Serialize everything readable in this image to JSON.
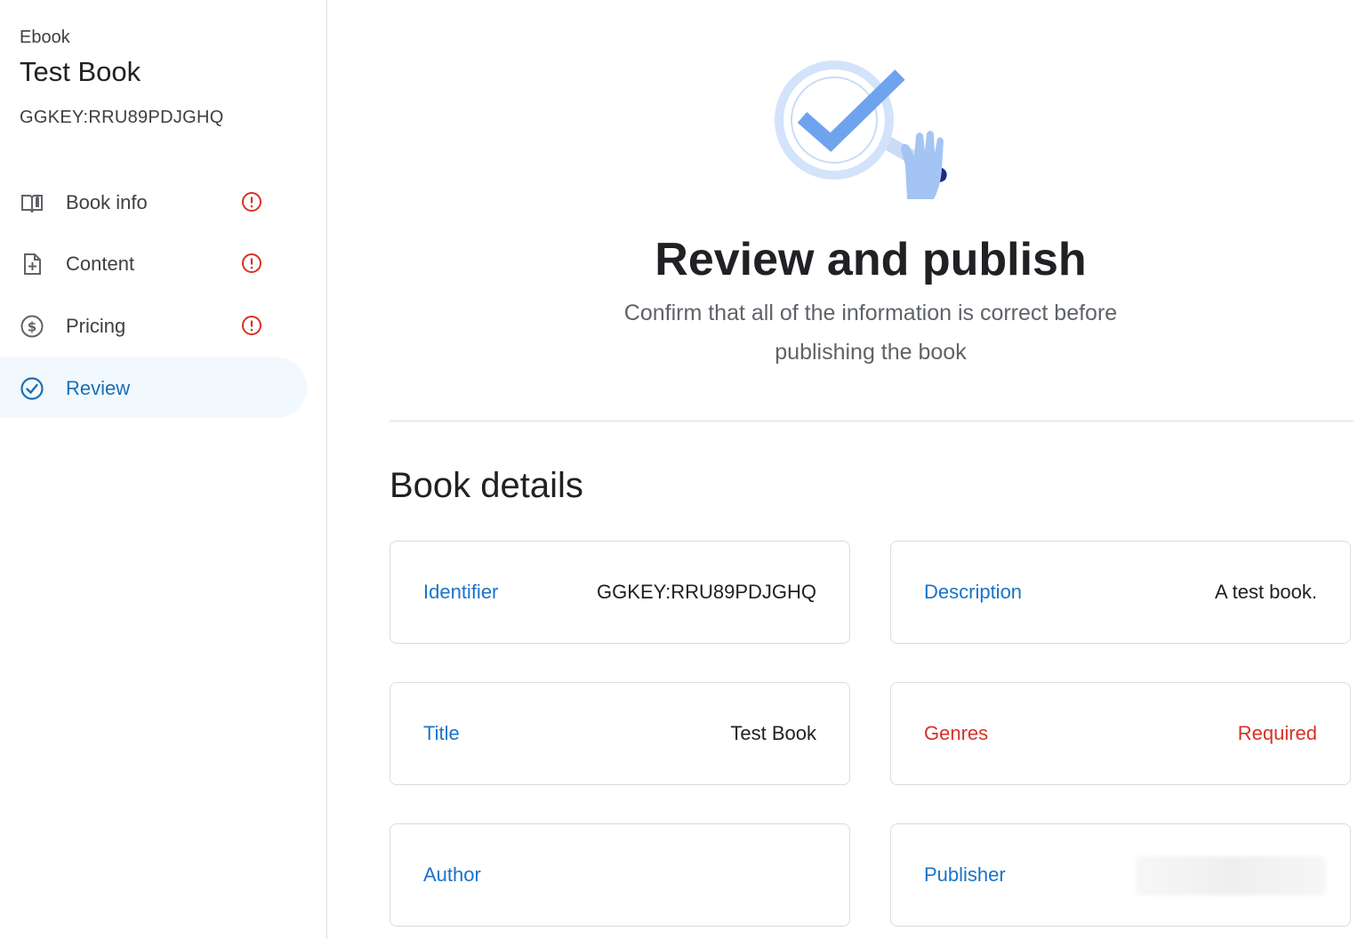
{
  "sidebar": {
    "book_type": "Ebook",
    "book_title": "Test Book",
    "book_id": "GGKEY:RRU89PDJGHQ",
    "items": [
      {
        "label": "Book info",
        "icon": "book-open-icon",
        "status": "error"
      },
      {
        "label": "Content",
        "icon": "file-add-icon",
        "status": "error"
      },
      {
        "label": "Pricing",
        "icon": "dollar-circle-icon",
        "status": "error"
      },
      {
        "label": "Review",
        "icon": "check-circle-icon",
        "status": "active"
      }
    ]
  },
  "main": {
    "illustration": "magnifier-check-icon",
    "heading": "Review and publish",
    "subtitle": "Confirm that all of the information is correct before publishing the book",
    "section_title": "Book details",
    "cards": {
      "identifier": {
        "label": "Identifier",
        "value": "GGKEY:RRU89PDJGHQ"
      },
      "description": {
        "label": "Description",
        "value": "A test book."
      },
      "title": {
        "label": "Title",
        "value": "Test Book"
      },
      "genres": {
        "label": "Genres",
        "value": "Required"
      },
      "author": {
        "label": "Author",
        "value": ""
      },
      "publisher": {
        "label": "Publisher",
        "value": ""
      }
    }
  },
  "colors": {
    "accent": "#1a73c8",
    "active_bg": "#f1f8fe",
    "error": "#d93025"
  }
}
